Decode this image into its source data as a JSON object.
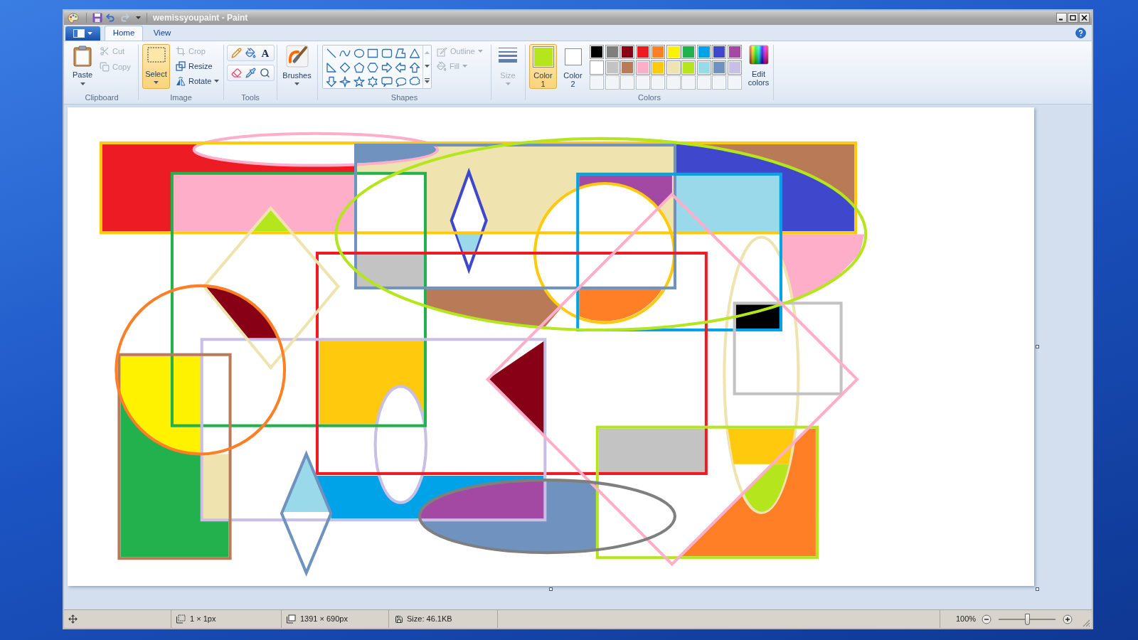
{
  "window": {
    "title": "wemissyoupaint - Paint"
  },
  "tabs": [
    {
      "label": "Home",
      "selected": true
    },
    {
      "label": "View",
      "selected": false
    }
  ],
  "ribbon": {
    "clipboard": {
      "label": "Clipboard",
      "paste": {
        "label": "Paste"
      },
      "cut": {
        "label": "Cut",
        "disabled": true
      },
      "copy": {
        "label": "Copy",
        "disabled": true
      }
    },
    "image": {
      "label": "Image",
      "select": {
        "label": "Select",
        "selected": true
      },
      "crop": {
        "label": "Crop",
        "disabled": true
      },
      "resize": {
        "label": "Resize",
        "disabled": false
      },
      "rotate": {
        "label": "Rotate",
        "disabled": false
      }
    },
    "tools": {
      "label": "Tools",
      "text_tool": "A"
    },
    "brushes": {
      "label": "Brushes"
    },
    "shapes": {
      "label": "Shapes",
      "outline": {
        "label": "Outline",
        "disabled": true
      },
      "fill": {
        "label": "Fill",
        "disabled": true
      }
    },
    "size": {
      "label": "Size",
      "disabled": true
    },
    "colors": {
      "label": "Colors",
      "active": [
        {
          "label": "Color 1",
          "color": "#b5e61d",
          "selected": true
        },
        {
          "label": "Color 2",
          "color": "#ffffff",
          "selected": false
        }
      ],
      "palette": [
        {
          "kind": "swatch",
          "color": "#000000"
        },
        {
          "kind": "swatch",
          "color": "#7f7f7f"
        },
        {
          "kind": "swatch",
          "color": "#880015"
        },
        {
          "kind": "swatch",
          "color": "#ed1c24"
        },
        {
          "kind": "swatch",
          "color": "#ff7f27"
        },
        {
          "kind": "swatch",
          "color": "#fff200"
        },
        {
          "kind": "swatch",
          "color": "#22b14c"
        },
        {
          "kind": "swatch",
          "color": "#00a2e8"
        },
        {
          "kind": "swatch",
          "color": "#3f48cc"
        },
        {
          "kind": "swatch",
          "color": "#a349a4"
        },
        {
          "kind": "swatch",
          "color": "#ffffff"
        },
        {
          "kind": "swatch",
          "color": "#c3c3c3"
        },
        {
          "kind": "swatch",
          "color": "#b97a57"
        },
        {
          "kind": "swatch",
          "color": "#ffaec9"
        },
        {
          "kind": "swatch",
          "color": "#ffc90e"
        },
        {
          "kind": "swatch",
          "color": "#efe4b0"
        },
        {
          "kind": "swatch",
          "color": "#b5e61d"
        },
        {
          "kind": "swatch",
          "color": "#99d9ea"
        },
        {
          "kind": "swatch",
          "color": "#7092be"
        },
        {
          "kind": "swatch",
          "color": "#c8bfe7"
        },
        {
          "kind": "empty"
        },
        {
          "kind": "empty"
        },
        {
          "kind": "empty"
        },
        {
          "kind": "empty"
        },
        {
          "kind": "empty"
        },
        {
          "kind": "empty"
        },
        {
          "kind": "empty"
        },
        {
          "kind": "empty"
        },
        {
          "kind": "empty"
        },
        {
          "kind": "empty"
        }
      ],
      "edit": {
        "label": "Edit colors"
      }
    }
  },
  "status_bar": {
    "selection_size": "1 × 1px",
    "canvas_size": "1391 × 690px",
    "file_size": "Size: 46.1KB",
    "zoom": "100%",
    "zoom_slider": {
      "level": 0.5
    }
  }
}
